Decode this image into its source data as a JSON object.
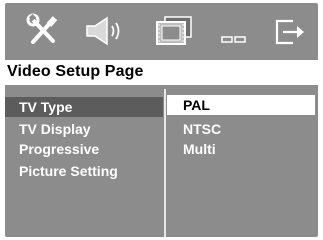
{
  "colors": {
    "panel_background": "#8c8c8c",
    "selected_menu_background": "#5c5c5c",
    "highlight_background": "#ffffff",
    "text": "#ffffff",
    "highlight_text": "#000000"
  },
  "toolbar": {
    "icons": [
      {
        "name": "tools-icon"
      },
      {
        "name": "speaker-icon"
      },
      {
        "name": "film-strip-icon"
      },
      {
        "name": "dots-icon"
      },
      {
        "name": "exit-icon"
      }
    ]
  },
  "page": {
    "title": "Video Setup Page"
  },
  "menu": {
    "items": [
      {
        "label": "TV Type",
        "selected": true
      },
      {
        "label": "TV Display",
        "selected": false
      },
      {
        "label": "Progressive",
        "selected": false
      },
      {
        "label": "Picture Setting",
        "selected": false
      }
    ]
  },
  "options": {
    "items": [
      {
        "label": "PAL",
        "highlighted": true
      },
      {
        "label": "NTSC",
        "highlighted": false
      },
      {
        "label": "Multi",
        "highlighted": false
      }
    ]
  }
}
